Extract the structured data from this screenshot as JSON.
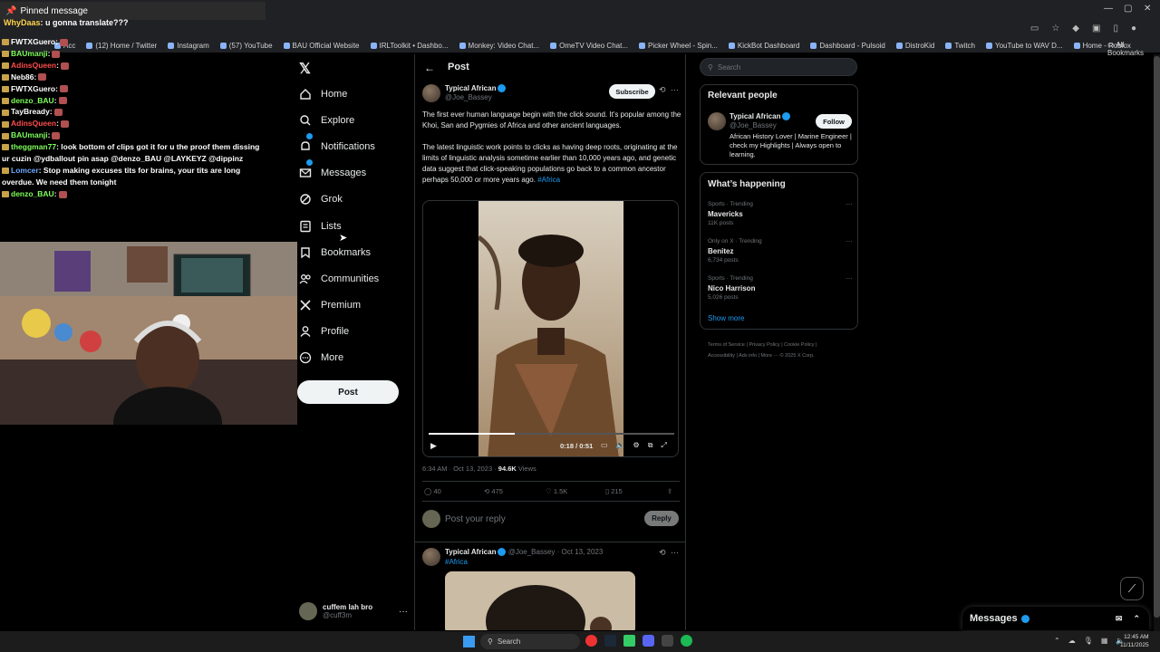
{
  "browser": {
    "bookmarks": [
      "Acc",
      "(12) Home / Twitter",
      "Instagram",
      "(57) YouTube",
      "BAU Official Website",
      "IRLToolkit • Dashbo...",
      "Monkey: Video Chat...",
      "OmeTV Video Chat...",
      "Picker Wheel - Spin...",
      "KickBot Dashboard",
      "Dashboard - Pulsoid",
      "DistroKid",
      "Twitch",
      "YouTube to WAV D...",
      "Home - Roblox"
    ],
    "all_bookmarks": "All Bookmarks"
  },
  "overlay": {
    "pinned_title": "Pinned message",
    "pinned_user": "WhyDaas",
    "pinned_text": ": u gonna translate???",
    "chat": [
      {
        "user": "FWTXGuero",
        "color": "#ffffff",
        "text": ":"
      },
      {
        "user": "BAUmanji",
        "color": "#7fff5a",
        "text": ":"
      },
      {
        "user": "AdinsQueen",
        "color": "#ff4d4d",
        "text": ":"
      },
      {
        "user": "Neb86",
        "color": "#ffffff",
        "text": ":"
      },
      {
        "user": "FWTXGuero",
        "color": "#ffffff",
        "text": ":"
      },
      {
        "user": "denzo_BAU",
        "color": "#7fff5a",
        "text": ":"
      },
      {
        "user": "TayBready",
        "color": "#ffffff",
        "text": ":"
      },
      {
        "user": "AdinsQueen",
        "color": "#ff4d4d",
        "text": ":"
      },
      {
        "user": "BAUmanji",
        "color": "#7fff5a",
        "text": ":"
      },
      {
        "user": "theggman77",
        "color": "#7fff5a",
        "text": ": look bottom of clips got it for u the proof them dissing ur cuzin @ydballout pin asap @denzo_BAU @LAYKEYZ @dippinz"
      },
      {
        "user": "Lomcer",
        "color": "#6ea8ff",
        "text": ": Stop making excuses tits for brains, your tits are long overdue. We need them tonight"
      },
      {
        "user": "denzo_BAU",
        "color": "#7fff5a",
        "text": ":"
      }
    ]
  },
  "nav": {
    "items": [
      {
        "label": "Home",
        "icon": "home-icon"
      },
      {
        "label": "Explore",
        "icon": "search-icon"
      },
      {
        "label": "Notifications",
        "icon": "bell-icon"
      },
      {
        "label": "Messages",
        "icon": "mail-icon"
      },
      {
        "label": "Grok",
        "icon": "grok-icon"
      },
      {
        "label": "Lists",
        "icon": "list-icon"
      },
      {
        "label": "Bookmarks",
        "icon": "bookmark-icon"
      },
      {
        "label": "Communities",
        "icon": "people-icon"
      },
      {
        "label": "Premium",
        "icon": "x-icon"
      },
      {
        "label": "Profile",
        "icon": "person-icon"
      },
      {
        "label": "More",
        "icon": "more-icon"
      }
    ],
    "post_label": "Post",
    "account_name": "cuffem lah bro",
    "account_handle": "@cuff3m"
  },
  "main": {
    "header": "Post",
    "post": {
      "name": "Typical African",
      "handle": "@Joe_Bassey",
      "subscribe": "Subscribe",
      "text1": "The first ever human language begin with the click sound. It’s popular among the Khoi, San and Pygmies of Africa and other ancient languages.",
      "text2": "The latest linguistic work points to clicks as having deep roots, originating at the limits of linguistic analysis sometime earlier than 10,000 years ago, and genetic data suggest that click-speaking populations go back to a common ancestor perhaps 50,000 or more years ago.",
      "hashtag": "#Africa",
      "video_time": "0:18 / 0:51",
      "progress": 0.35,
      "timestamp": "6:34 AM · Oct 13, 2023 · ",
      "views": "94.6K",
      "views_label": " Views",
      "stats": {
        "replies": "40",
        "reposts": "475",
        "likes": "1.5K",
        "bookmarks": "215"
      },
      "reply_placeholder": "Post your reply",
      "reply_button": "Reply"
    },
    "reply_post": {
      "name": "Typical African",
      "meta": "@Joe_Bassey · Oct 13, 2023",
      "hashtag": "#Africa"
    }
  },
  "right": {
    "search_placeholder": "Search",
    "relevant_title": "Relevant people",
    "person_name": "Typical African",
    "person_handle": "@Joe_Bassey",
    "follow": "Follow",
    "person_bio": "African History Lover | Marine Engineer | check my Highlights | Always open to learning.",
    "happening_title": "What’s happening",
    "trends": [
      {
        "context": "Sports · Trending",
        "name": "Mavericks",
        "count": "11K posts"
      },
      {
        "context": "Only on X · Trending",
        "name": "Benitez",
        "count": "6,734 posts"
      },
      {
        "context": "Sports · Trending",
        "name": "Nico Harrison",
        "count": "5,026 posts"
      }
    ],
    "show_more": "Show more",
    "footer1": "Terms of Service  |  Privacy Policy  |  Cookie Policy  |",
    "footer2": "Accessibility  |  Ads info  |  More ···  © 2025 X Corp.",
    "messages_drawer": "Messages"
  },
  "taskbar": {
    "search": "Search",
    "time": "12:45 AM",
    "date": "11/11/2025"
  }
}
